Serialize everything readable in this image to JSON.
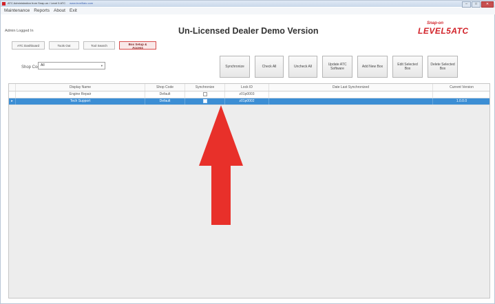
{
  "window": {
    "title": "ATC Administration from Snap-on / Level 5 ATC",
    "url": "www.level5atc.com",
    "controls": [
      "–",
      "□",
      "✕"
    ]
  },
  "menu": [
    "Maintenance",
    "Reports",
    "About",
    "Exit"
  ],
  "status": {
    "admin_logged_in": "Admin Logged In"
  },
  "heading": "Un-Licensed Dealer Demo Version",
  "logo": {
    "brand": "Snap-on",
    "text": "LEVEL5ATC"
  },
  "tabs": [
    {
      "label": "ATC Dashboard",
      "active": false
    },
    {
      "label": "Tools Out",
      "active": false
    },
    {
      "label": "Tool Search",
      "active": false
    },
    {
      "label": "Box Setup & Access",
      "active": true
    }
  ],
  "filter": {
    "label": "Shop Code",
    "value": "All"
  },
  "actions": [
    "Synchronize",
    "Check All",
    "Uncheck All",
    "Update ATC Software",
    "Add New Box",
    "Edit Selected Box",
    "Delete Selected Box"
  ],
  "table": {
    "columns": [
      "Display Name",
      "Shop Code",
      "Synchronize",
      "Lock ID",
      "Date Last Synchronized",
      "Current Version"
    ],
    "rows": [
      {
        "display_name": "Engine Repair",
        "shop_code": "Default",
        "synchronize": false,
        "lock_id": "z01p0003",
        "date_last_synchronized": "",
        "current_version": "",
        "selected": false
      },
      {
        "display_name": "Tech Support",
        "shop_code": "Default",
        "synchronize": false,
        "lock_id": "z01p0002",
        "date_last_synchronized": "",
        "current_version": "1.0.0.0",
        "selected": true
      }
    ]
  },
  "colors": {
    "selection": "#3c8ed4",
    "accent_red": "#e8302a",
    "brand_red": "#d2232a"
  }
}
